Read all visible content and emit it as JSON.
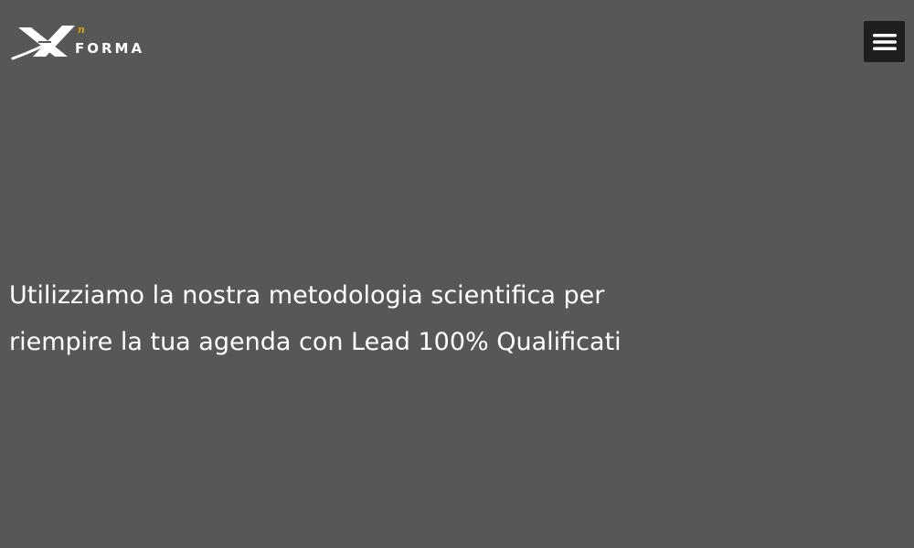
{
  "header": {
    "logo": {
      "text": "FORMA",
      "mark": "X",
      "superscript": "n",
      "accent_color": "#d4a017"
    },
    "menu_button": {
      "icon": "hamburger-menu-icon"
    }
  },
  "hero": {
    "line1": "Utilizziamo la nostra metodologia scientifica per",
    "line2": "riempire la tua agenda con Lead 100% Qualificati"
  },
  "colors": {
    "background": "#575757",
    "text": "#ffffff",
    "menu_button_bg": "#1e1e1e"
  }
}
